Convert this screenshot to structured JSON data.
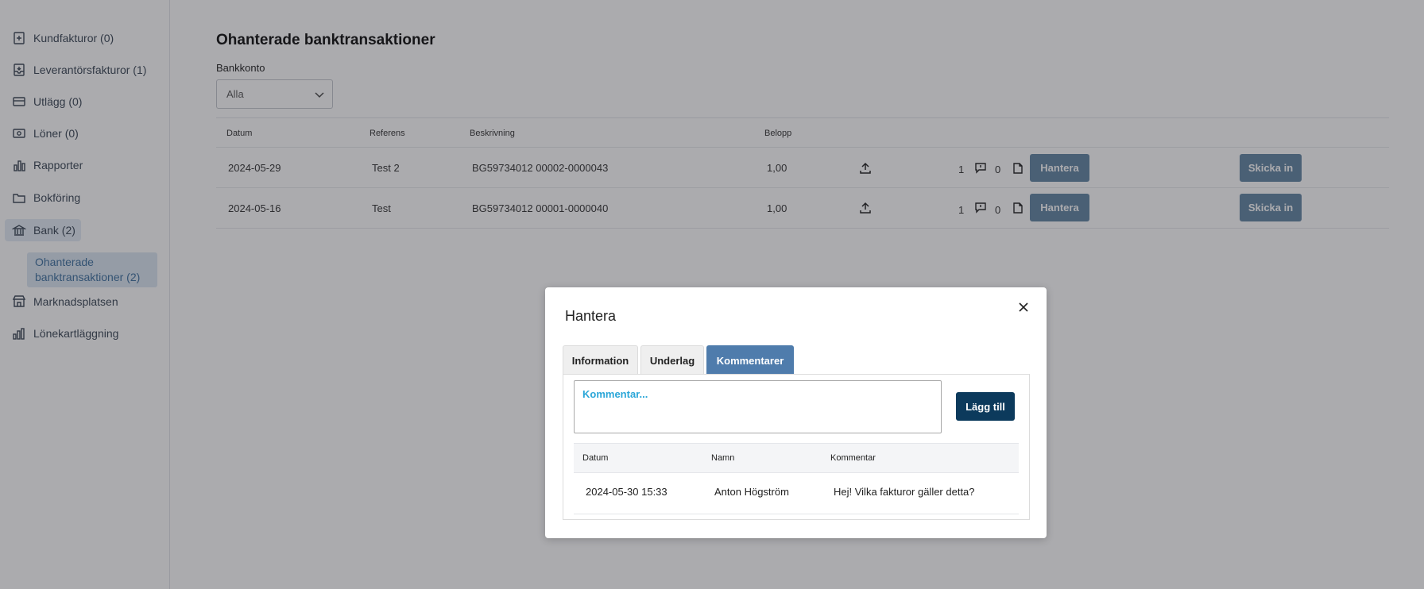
{
  "sidebar": {
    "items": [
      {
        "label": "Kundfakturor (0)",
        "icon": "invoice-icon"
      },
      {
        "label": "Leverantörsfakturor (1)",
        "icon": "inbox-icon"
      },
      {
        "label": "Utlägg (0)",
        "icon": "card-icon"
      },
      {
        "label": "Löner (0)",
        "icon": "money-icon"
      },
      {
        "label": "Rapporter",
        "icon": "bar-chart-icon"
      },
      {
        "label": "Bokföring",
        "icon": "folder-icon"
      },
      {
        "label": "Bank (2)",
        "icon": "bank-icon"
      },
      {
        "label": "Marknadsplatsen",
        "icon": "store-icon"
      },
      {
        "label": "Lönekartläggning",
        "icon": "chart-icon"
      }
    ],
    "sub_item": "Ohanterade banktransaktioner (2)"
  },
  "main": {
    "title": "Ohanterade banktransaktioner",
    "bank_label": "Bankkonto",
    "bank_select": "Alla",
    "columns": [
      "Datum",
      "Referens",
      "Beskrivning",
      "Belopp"
    ],
    "rows": [
      {
        "datum": "2024-05-29",
        "referens": "Test 2",
        "beskrivning": "BG59734012 00002-0000043",
        "belopp": "1,00",
        "count1": "1",
        "count2": "0",
        "hantera": "Hantera",
        "skicka": "Skicka in"
      },
      {
        "datum": "2024-05-16",
        "referens": "Test",
        "beskrivning": "BG59734012 00001-0000040",
        "belopp": "1,00",
        "count1": "1",
        "count2": "0",
        "hantera": "Hantera",
        "skicka": "Skicka in"
      }
    ]
  },
  "modal": {
    "title": "Hantera",
    "tabs": [
      "Information",
      "Underlag",
      "Kommentarer"
    ],
    "active_tab": "Kommentarer",
    "comment_placeholder": "Kommentar...",
    "add_button": "Lägg till",
    "columns": [
      "Datum",
      "Namn",
      "Kommentar"
    ],
    "comments": [
      {
        "datum": "2024-05-30 15:33",
        "namn": "Anton Högström",
        "kommentar": "Hej! Vilka fakturor gäller detta?"
      }
    ]
  },
  "colors": {
    "accent": "#4f7cac",
    "primary_button": "#0c3a5c",
    "gray_button": "#6f8fab",
    "placeholder_text": "#2aa6d8"
  }
}
